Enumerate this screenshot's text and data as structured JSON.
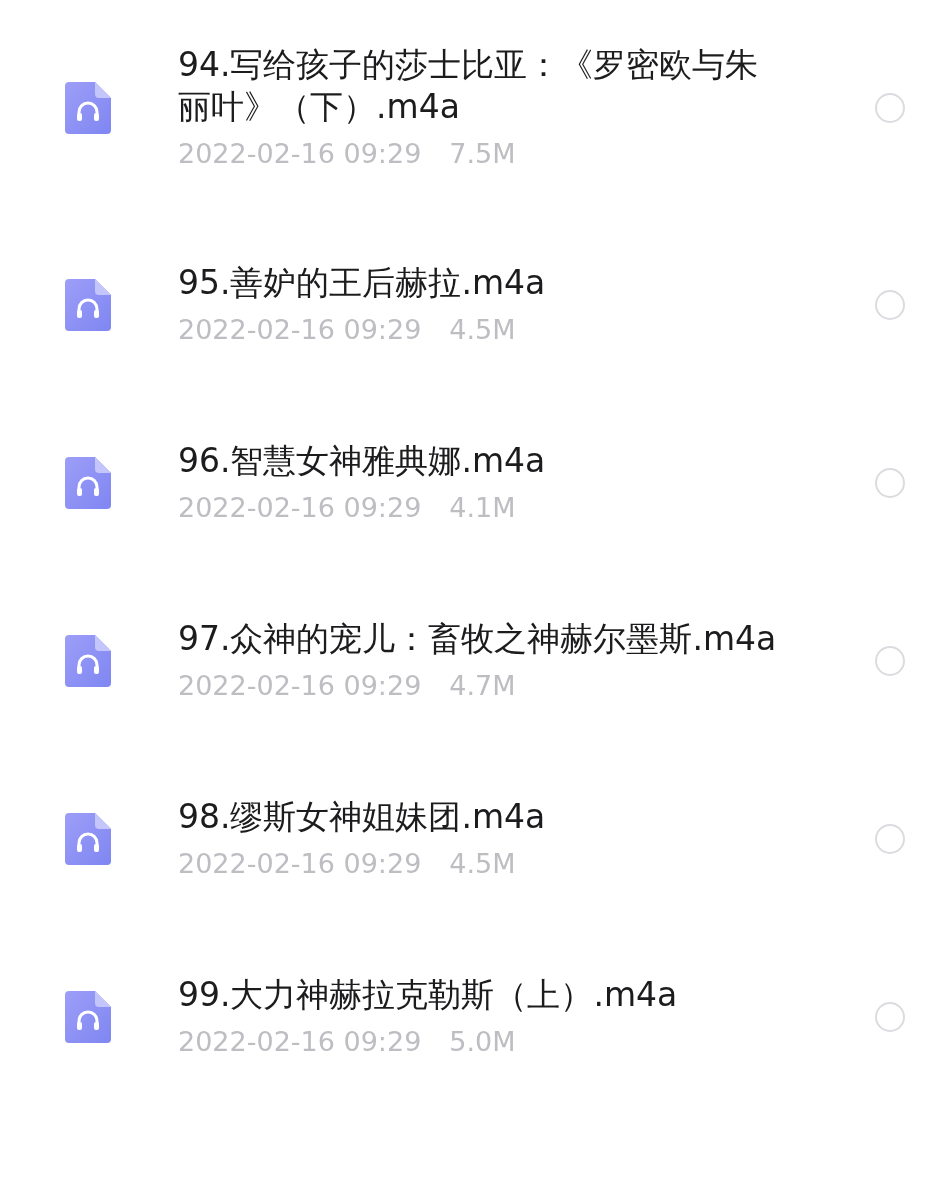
{
  "files": [
    {
      "name": "94.写给孩子的莎士比亚：《罗密欧与朱丽叶》（下）.m4a",
      "date": "2022-02-16 09:29",
      "size": "7.5M",
      "selected": false
    },
    {
      "name": "95.善妒的王后赫拉.m4a",
      "date": "2022-02-16 09:29",
      "size": "4.5M",
      "selected": false
    },
    {
      "name": "96.智慧女神雅典娜.m4a",
      "date": "2022-02-16 09:29",
      "size": "4.1M",
      "selected": false
    },
    {
      "name": "97.众神的宠儿：畜牧之神赫尔墨斯.m4a",
      "date": "2022-02-16 09:29",
      "size": "4.7M",
      "selected": false
    },
    {
      "name": "98.缪斯女神姐妹团.m4a",
      "date": "2022-02-16 09:29",
      "size": "4.5M",
      "selected": false
    },
    {
      "name": "99.大力神赫拉克勒斯（上）.m4a",
      "date": "2022-02-16 09:29",
      "size": "5.0M",
      "selected": false
    }
  ]
}
